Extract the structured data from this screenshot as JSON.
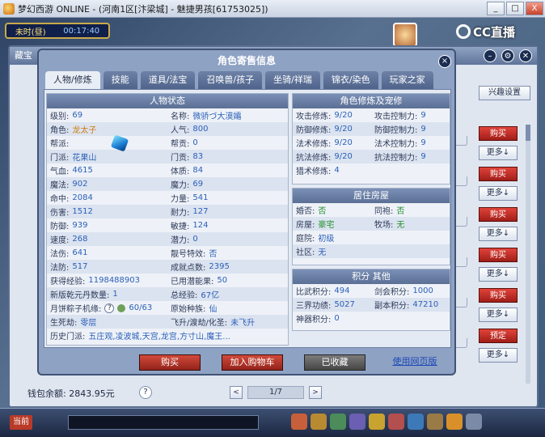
{
  "window": {
    "title": "梦幻西游 ONLINE - (河南1区[汴梁城] - 魅捷男孩[61753025])",
    "min": "_",
    "max": "□",
    "close": "X"
  },
  "hud": {
    "time_label": "未时(昼)",
    "clock": "00:17:40",
    "cc_brand": "CC直播"
  },
  "tradeshop": {
    "title": "藏宝",
    "interest_button": "兴趣设置",
    "buy_label": "购买",
    "reserve_label": "预定",
    "more_label": "更多↓",
    "rows": [
      {
        "action": "购买"
      },
      {
        "action": "购买"
      },
      {
        "action": "购买"
      },
      {
        "action": "购买"
      },
      {
        "action": "购买"
      },
      {
        "action": "预定"
      }
    ],
    "wallet": "钱包余额: 2843.95元",
    "help": "?",
    "page": "1/7",
    "prev": "<",
    "next": ">"
  },
  "toolbar": {
    "channel": "当前"
  },
  "dialog": {
    "title": "角色寄售信息",
    "close": "×",
    "tabs": [
      "人物/修炼",
      "技能",
      "道具/法宝",
      "召唤兽/孩子",
      "坐骑/祥瑞",
      "锦衣/染色",
      "玩家之家"
    ],
    "status_header": "人物状态",
    "status": {
      "level_label": "级别:",
      "level": "69",
      "name_label": "名称:",
      "name": "微骄づ大漠孀",
      "role_label": "角色:",
      "role": "龙太子",
      "pop_label": "人气:",
      "pop": "800",
      "gang_label": "帮派:",
      "gang": "",
      "gangcontrib_label": "帮贡:",
      "gangcontrib": "0",
      "school_label": "门派:",
      "school": "花果山",
      "schoolcontrib_label": "门贡:",
      "schoolcontrib": "83",
      "hp_label": "气血:",
      "hp": "4615",
      "physique_label": "体质:",
      "physique": "84",
      "mp_label": "魔法:",
      "mp": "902",
      "magic_label": "魔力:",
      "magic": "69",
      "hit_label": "命中:",
      "hit": "2084",
      "power_label": "力量:",
      "power": "541",
      "dmg_label": "伤害:",
      "dmg": "1512",
      "endurance_label": "耐力:",
      "endurance": "127",
      "def_label": "防御:",
      "def": "939",
      "agility_label": "敏捷:",
      "agility": "124",
      "speed_label": "速度:",
      "speed": "268",
      "potential_label": "潜力:",
      "potential": "0",
      "spell_label": "法伤:",
      "spell": "641",
      "fx_label": "靓号特效:",
      "fx": "否",
      "sdef_label": "法防:",
      "sdef": "517",
      "achieve_label": "成就点数:",
      "achieve": "2395",
      "exp_label": "获得经验:",
      "exp": "1198488903",
      "usedpot_label": "已用潜能果:",
      "usedpot": "50",
      "qk_label": "新版乾元丹数量:",
      "qk": "1",
      "totalexp_label": "总经验:",
      "totalexp": "67亿",
      "mooncake_label": "月饼粽子机缘:",
      "mooncake": "60/63",
      "race_label": "原始种族:",
      "race": "仙",
      "life_label": "生死劫:",
      "life": "零层",
      "fly_label": "飞升/渡劫/化圣:",
      "fly": "未飞升",
      "hist_label": "历史门派:",
      "hist": "五庄观,凌波城,天宫,龙宫,方寸山,魔王..."
    },
    "cultivation_header": "角色修炼及宠修",
    "cultivation": [
      [
        "攻击修炼:",
        "9/20",
        "攻击控制力:",
        "9"
      ],
      [
        "防御修炼:",
        "9/20",
        "防御控制力:",
        "9"
      ],
      [
        "法术修炼:",
        "9/20",
        "法术控制力:",
        "9"
      ],
      [
        "抗法修炼:",
        "9/20",
        "抗法控制力:",
        "9"
      ],
      [
        "猎术修炼:",
        "4",
        "",
        ""
      ]
    ],
    "house_header": "居住房屋",
    "house": [
      [
        "婚否:",
        "否",
        "同袍:",
        "否"
      ],
      [
        "房屋:",
        "豪宅",
        "牧场:",
        "无"
      ],
      [
        "庭院:",
        "初级",
        "",
        ""
      ],
      [
        "社区:",
        "无",
        "",
        ""
      ]
    ],
    "score_header": "积分 其他",
    "score": [
      [
        "比武积分:",
        "494",
        "剑会积分:",
        "1000"
      ],
      [
        "三界功绩:",
        "5027",
        "副本积分:",
        "47210"
      ],
      [
        "神器积分:",
        "0",
        "",
        ""
      ]
    ],
    "buttons": {
      "buy": "购买",
      "add_cart": "加入购物车",
      "collected": "已收藏",
      "web_version": "使用网页版"
    }
  },
  "colors": {
    "buy_red": "#c0312a",
    "accent_blue": "#2b5fb8",
    "panel_header": "#6a7fa6"
  }
}
